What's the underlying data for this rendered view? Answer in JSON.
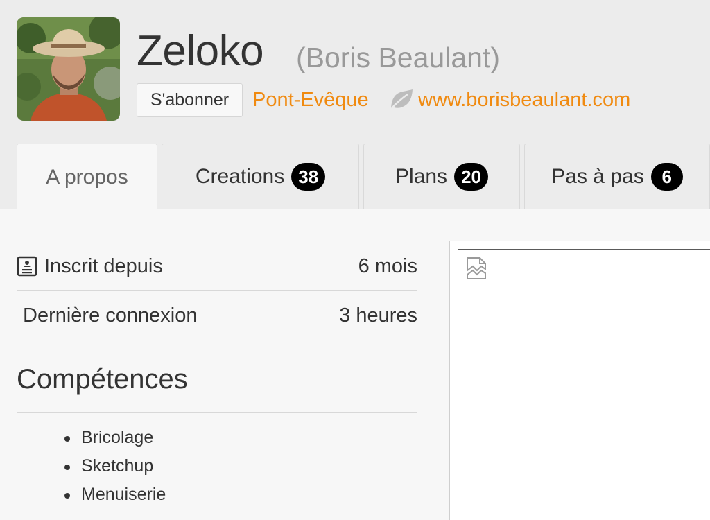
{
  "profile": {
    "username": "Zeloko",
    "real_name": "(Boris Beaulant)",
    "subscribe_label": "S'abonner",
    "location": "Pont-Evêque",
    "website": "www.borisbeaulant.com",
    "avatar_icon": "user-photo",
    "location_icon": "leaf-icon"
  },
  "tabs": [
    {
      "label": "A propos",
      "count": null,
      "active": true
    },
    {
      "label": "Creations",
      "count": "38",
      "active": false
    },
    {
      "label": "Plans",
      "count": "20",
      "active": false
    },
    {
      "label": "Pas à pas",
      "count": "6",
      "active": false
    }
  ],
  "stats": [
    {
      "label": "Inscrit depuis",
      "value": "6 mois",
      "icon": "id-card-icon"
    },
    {
      "label": "Dernière connexion",
      "value": "3 heures"
    }
  ],
  "skills": {
    "title": "Compétences",
    "items": [
      "Bricolage",
      "Sketchup",
      "Menuiserie"
    ]
  },
  "map": {
    "icon": "broken-image-icon"
  },
  "colors": {
    "accent": "#f08a10",
    "header_bg": "#ececec",
    "page_bg": "#f7f7f7",
    "badge_bg": "#000000"
  }
}
